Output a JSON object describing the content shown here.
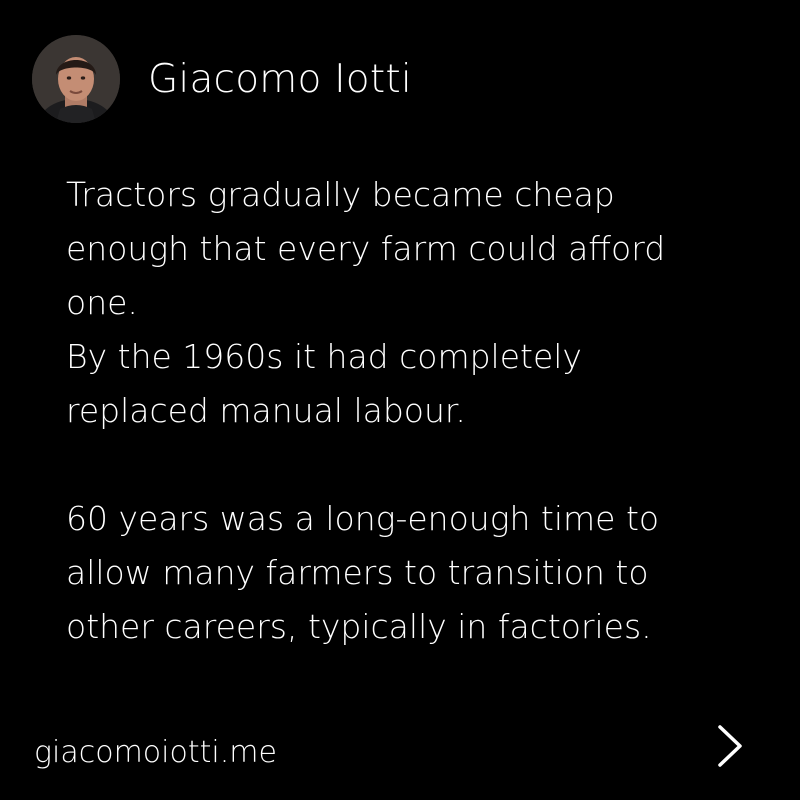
{
  "header": {
    "author_name": "Giacomo Iotti",
    "avatar_icon": "person-photo-avatar"
  },
  "post": {
    "paragraph1": {
      "line1": "Tractors gradually became cheap",
      "line2": "enough that every farm could afford",
      "line3": "one.",
      "line4": "By the 1960s it had completely",
      "line5": "replaced manual labour."
    },
    "paragraph2": {
      "line1": "60 years was a long-enough time to",
      "line2": "allow many farmers to transition to",
      "line3": "other careers, typically in factories."
    }
  },
  "footer": {
    "url": "giacomoiotti.me",
    "next_icon": "chevron-right-icon"
  },
  "colors": {
    "background": "#000000",
    "text": "#ffffff"
  }
}
